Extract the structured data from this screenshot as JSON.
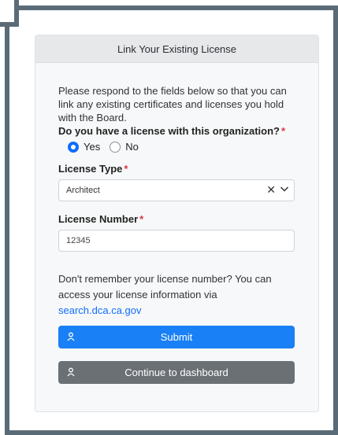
{
  "card": {
    "title": "Link Your Existing License",
    "intro": "Please respond to the fields below so that you can link any existing certificates and licenses you hold with the Board.",
    "question": "Do you have a license with this organization?",
    "required_mark": "*",
    "options": [
      {
        "label": "Yes",
        "selected": true
      },
      {
        "label": "No",
        "selected": false
      }
    ],
    "license_type": {
      "label": "License Type",
      "value": "Architect"
    },
    "license_number": {
      "label": "License Number",
      "value": "12345"
    },
    "help_text": "Don't remember your license number? You can access your license information via",
    "help_link": "search.dca.ca.gov",
    "submit_label": "Submit",
    "dashboard_label": "Continue to dashboard"
  },
  "colors": {
    "primary": "#1a80f5",
    "secondary": "#6b7075",
    "required": "#dc3545",
    "frame": "#5a6b78"
  },
  "icons": {
    "button_icon": "user-icon",
    "clear_icon": "close-icon",
    "dropdown_icon": "chevron-down-icon"
  }
}
